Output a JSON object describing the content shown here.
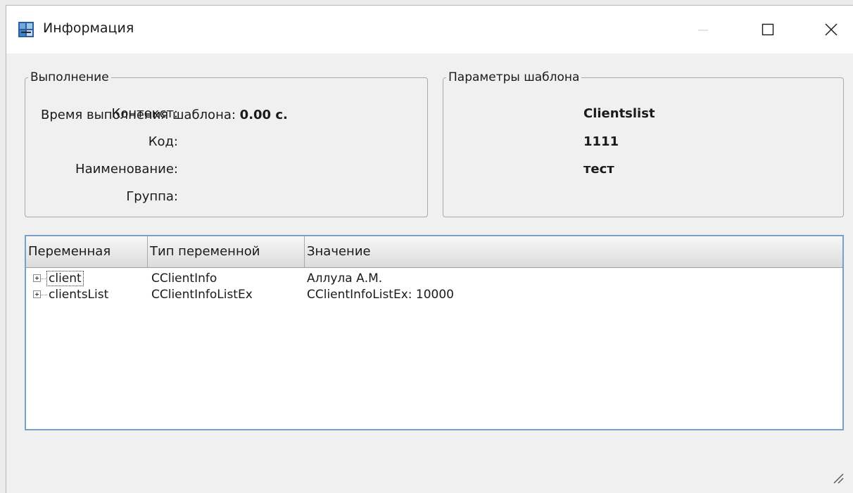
{
  "window": {
    "title": "Информация",
    "controls": {
      "minimize_icon": "minimize-icon",
      "maximize_icon": "maximize-icon",
      "close_icon": "close-icon"
    }
  },
  "execution": {
    "legend": "Выполнение",
    "time_label": "Время выполнения шаблона:",
    "time_value": "0.00 с."
  },
  "params": {
    "legend": "Параметры шаблона",
    "rows": [
      {
        "label": "Контекст:",
        "value": "Clientslist"
      },
      {
        "label": "Код:",
        "value": "1111"
      },
      {
        "label": "Наименование:",
        "value": "тест"
      },
      {
        "label": "Группа:",
        "value": ""
      }
    ]
  },
  "tree": {
    "columns": [
      "Переменная",
      "Тип переменной",
      "Значение"
    ],
    "rows": [
      {
        "name": "client",
        "type": "CClientInfo",
        "value": "Аллула А.М."
      },
      {
        "name": "clientsList",
        "type": "CClientInfoListEx",
        "value": "CClientInfoListEx: 10000"
      }
    ]
  },
  "colors": {
    "tree_border": "#7aa0c9",
    "window_bg": "#f0f0f0"
  }
}
